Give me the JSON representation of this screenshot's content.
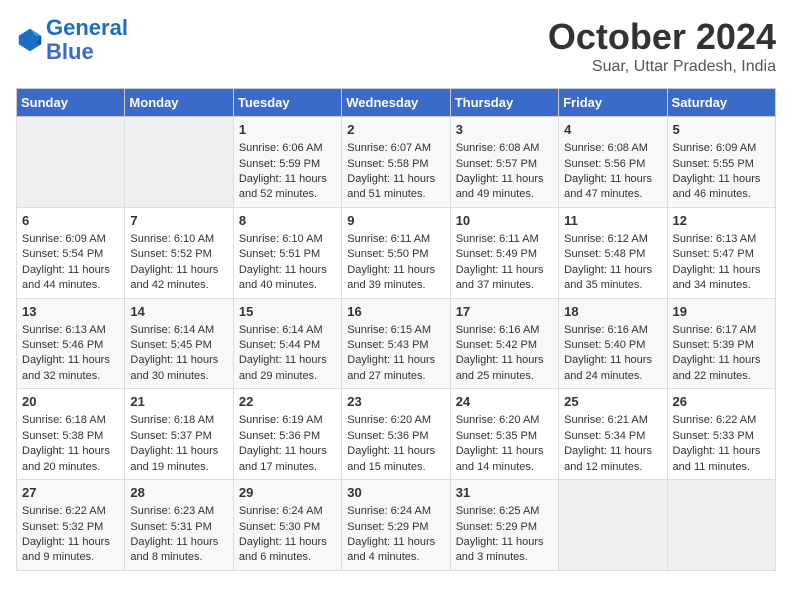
{
  "header": {
    "logo_line1": "General",
    "logo_line2": "Blue",
    "month_year": "October 2024",
    "location": "Suar, Uttar Pradesh, India"
  },
  "days_of_week": [
    "Sunday",
    "Monday",
    "Tuesday",
    "Wednesday",
    "Thursday",
    "Friday",
    "Saturday"
  ],
  "weeks": [
    [
      {
        "day": "",
        "empty": true
      },
      {
        "day": "",
        "empty": true
      },
      {
        "day": "1",
        "sunrise": "Sunrise: 6:06 AM",
        "sunset": "Sunset: 5:59 PM",
        "daylight": "Daylight: 11 hours and 52 minutes."
      },
      {
        "day": "2",
        "sunrise": "Sunrise: 6:07 AM",
        "sunset": "Sunset: 5:58 PM",
        "daylight": "Daylight: 11 hours and 51 minutes."
      },
      {
        "day": "3",
        "sunrise": "Sunrise: 6:08 AM",
        "sunset": "Sunset: 5:57 PM",
        "daylight": "Daylight: 11 hours and 49 minutes."
      },
      {
        "day": "4",
        "sunrise": "Sunrise: 6:08 AM",
        "sunset": "Sunset: 5:56 PM",
        "daylight": "Daylight: 11 hours and 47 minutes."
      },
      {
        "day": "5",
        "sunrise": "Sunrise: 6:09 AM",
        "sunset": "Sunset: 5:55 PM",
        "daylight": "Daylight: 11 hours and 46 minutes."
      }
    ],
    [
      {
        "day": "6",
        "sunrise": "Sunrise: 6:09 AM",
        "sunset": "Sunset: 5:54 PM",
        "daylight": "Daylight: 11 hours and 44 minutes."
      },
      {
        "day": "7",
        "sunrise": "Sunrise: 6:10 AM",
        "sunset": "Sunset: 5:52 PM",
        "daylight": "Daylight: 11 hours and 42 minutes."
      },
      {
        "day": "8",
        "sunrise": "Sunrise: 6:10 AM",
        "sunset": "Sunset: 5:51 PM",
        "daylight": "Daylight: 11 hours and 40 minutes."
      },
      {
        "day": "9",
        "sunrise": "Sunrise: 6:11 AM",
        "sunset": "Sunset: 5:50 PM",
        "daylight": "Daylight: 11 hours and 39 minutes."
      },
      {
        "day": "10",
        "sunrise": "Sunrise: 6:11 AM",
        "sunset": "Sunset: 5:49 PM",
        "daylight": "Daylight: 11 hours and 37 minutes."
      },
      {
        "day": "11",
        "sunrise": "Sunrise: 6:12 AM",
        "sunset": "Sunset: 5:48 PM",
        "daylight": "Daylight: 11 hours and 35 minutes."
      },
      {
        "day": "12",
        "sunrise": "Sunrise: 6:13 AM",
        "sunset": "Sunset: 5:47 PM",
        "daylight": "Daylight: 11 hours and 34 minutes."
      }
    ],
    [
      {
        "day": "13",
        "sunrise": "Sunrise: 6:13 AM",
        "sunset": "Sunset: 5:46 PM",
        "daylight": "Daylight: 11 hours and 32 minutes."
      },
      {
        "day": "14",
        "sunrise": "Sunrise: 6:14 AM",
        "sunset": "Sunset: 5:45 PM",
        "daylight": "Daylight: 11 hours and 30 minutes."
      },
      {
        "day": "15",
        "sunrise": "Sunrise: 6:14 AM",
        "sunset": "Sunset: 5:44 PM",
        "daylight": "Daylight: 11 hours and 29 minutes."
      },
      {
        "day": "16",
        "sunrise": "Sunrise: 6:15 AM",
        "sunset": "Sunset: 5:43 PM",
        "daylight": "Daylight: 11 hours and 27 minutes."
      },
      {
        "day": "17",
        "sunrise": "Sunrise: 6:16 AM",
        "sunset": "Sunset: 5:42 PM",
        "daylight": "Daylight: 11 hours and 25 minutes."
      },
      {
        "day": "18",
        "sunrise": "Sunrise: 6:16 AM",
        "sunset": "Sunset: 5:40 PM",
        "daylight": "Daylight: 11 hours and 24 minutes."
      },
      {
        "day": "19",
        "sunrise": "Sunrise: 6:17 AM",
        "sunset": "Sunset: 5:39 PM",
        "daylight": "Daylight: 11 hours and 22 minutes."
      }
    ],
    [
      {
        "day": "20",
        "sunrise": "Sunrise: 6:18 AM",
        "sunset": "Sunset: 5:38 PM",
        "daylight": "Daylight: 11 hours and 20 minutes."
      },
      {
        "day": "21",
        "sunrise": "Sunrise: 6:18 AM",
        "sunset": "Sunset: 5:37 PM",
        "daylight": "Daylight: 11 hours and 19 minutes."
      },
      {
        "day": "22",
        "sunrise": "Sunrise: 6:19 AM",
        "sunset": "Sunset: 5:36 PM",
        "daylight": "Daylight: 11 hours and 17 minutes."
      },
      {
        "day": "23",
        "sunrise": "Sunrise: 6:20 AM",
        "sunset": "Sunset: 5:36 PM",
        "daylight": "Daylight: 11 hours and 15 minutes."
      },
      {
        "day": "24",
        "sunrise": "Sunrise: 6:20 AM",
        "sunset": "Sunset: 5:35 PM",
        "daylight": "Daylight: 11 hours and 14 minutes."
      },
      {
        "day": "25",
        "sunrise": "Sunrise: 6:21 AM",
        "sunset": "Sunset: 5:34 PM",
        "daylight": "Daylight: 11 hours and 12 minutes."
      },
      {
        "day": "26",
        "sunrise": "Sunrise: 6:22 AM",
        "sunset": "Sunset: 5:33 PM",
        "daylight": "Daylight: 11 hours and 11 minutes."
      }
    ],
    [
      {
        "day": "27",
        "sunrise": "Sunrise: 6:22 AM",
        "sunset": "Sunset: 5:32 PM",
        "daylight": "Daylight: 11 hours and 9 minutes."
      },
      {
        "day": "28",
        "sunrise": "Sunrise: 6:23 AM",
        "sunset": "Sunset: 5:31 PM",
        "daylight": "Daylight: 11 hours and 8 minutes."
      },
      {
        "day": "29",
        "sunrise": "Sunrise: 6:24 AM",
        "sunset": "Sunset: 5:30 PM",
        "daylight": "Daylight: 11 hours and 6 minutes."
      },
      {
        "day": "30",
        "sunrise": "Sunrise: 6:24 AM",
        "sunset": "Sunset: 5:29 PM",
        "daylight": "Daylight: 11 hours and 4 minutes."
      },
      {
        "day": "31",
        "sunrise": "Sunrise: 6:25 AM",
        "sunset": "Sunset: 5:29 PM",
        "daylight": "Daylight: 11 hours and 3 minutes."
      },
      {
        "day": "",
        "empty": true
      },
      {
        "day": "",
        "empty": true
      }
    ]
  ]
}
